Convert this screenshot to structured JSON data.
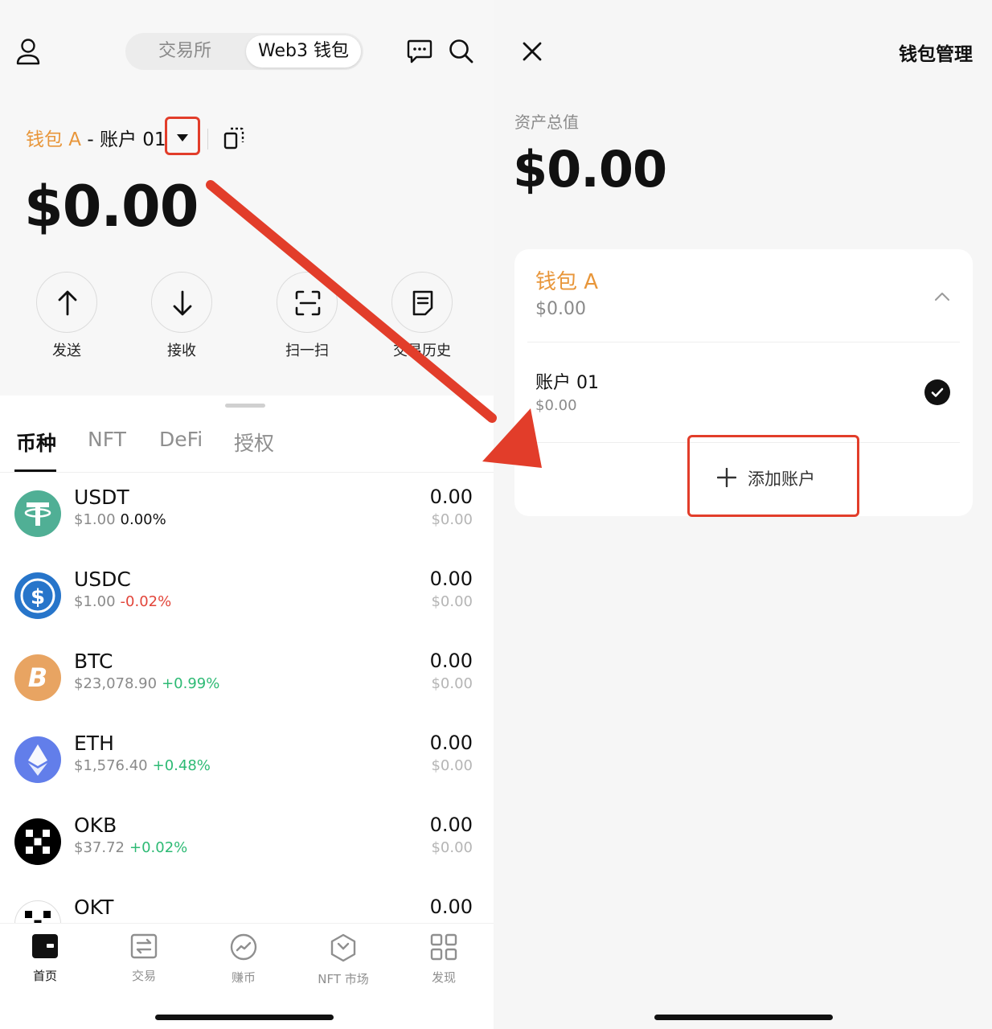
{
  "left": {
    "segment": {
      "exchange": "交易所",
      "web3": "Web3 钱包"
    },
    "wallet": {
      "name": "钱包 A",
      "separator": " - ",
      "account": "账户 01"
    },
    "balance": "$0.00",
    "actions": [
      {
        "label": "发送",
        "icon": "arrow-up-icon"
      },
      {
        "label": "接收",
        "icon": "arrow-down-icon"
      },
      {
        "label": "扫一扫",
        "icon": "scan-icon"
      },
      {
        "label": "交易历史",
        "icon": "history-icon"
      }
    ],
    "tabs": [
      "币种",
      "NFT",
      "DeFi",
      "授权"
    ],
    "tokens": [
      {
        "symbol": "USDT",
        "price": "$1.00",
        "change": "0.00%",
        "amount": "0.00",
        "value": "$0.00",
        "color": "#50af95"
      },
      {
        "symbol": "USDC",
        "price": "$1.00",
        "change": "-0.02%",
        "amount": "0.00",
        "value": "$0.00",
        "color": "#2775ca"
      },
      {
        "symbol": "BTC",
        "price": "$23,078.90",
        "change": "+0.99%",
        "amount": "0.00",
        "value": "$0.00",
        "color": "#e8a462"
      },
      {
        "symbol": "ETH",
        "price": "$1,576.40",
        "change": "+0.48%",
        "amount": "0.00",
        "value": "$0.00",
        "color": "#627eea"
      },
      {
        "symbol": "OKB",
        "price": "$37.72",
        "change": "+0.02%",
        "amount": "0.00",
        "value": "$0.00",
        "color": "#000000"
      },
      {
        "symbol": "OKT",
        "price": "",
        "change": "",
        "amount": "0.00",
        "value": "",
        "color": "#000000"
      }
    ],
    "nav": [
      {
        "label": "首页",
        "icon": "wallet-icon"
      },
      {
        "label": "交易",
        "icon": "trade-icon"
      },
      {
        "label": "赚币",
        "icon": "earn-icon"
      },
      {
        "label": "NFT 市场",
        "icon": "nft-market-icon"
      },
      {
        "label": "发现",
        "icon": "discover-icon"
      }
    ]
  },
  "right": {
    "title": "钱包管理",
    "total_label": "资产总值",
    "total_value": "$0.00",
    "wallet_name": "钱包 A",
    "wallet_balance": "$0.00",
    "account_name": "账户 01",
    "account_balance": "$0.00",
    "add_account": "添加账户"
  },
  "colors": {
    "accent": "#e8963a",
    "highlight": "#e23d2a",
    "positive": "#2dba74",
    "negative": "#e2453a"
  }
}
